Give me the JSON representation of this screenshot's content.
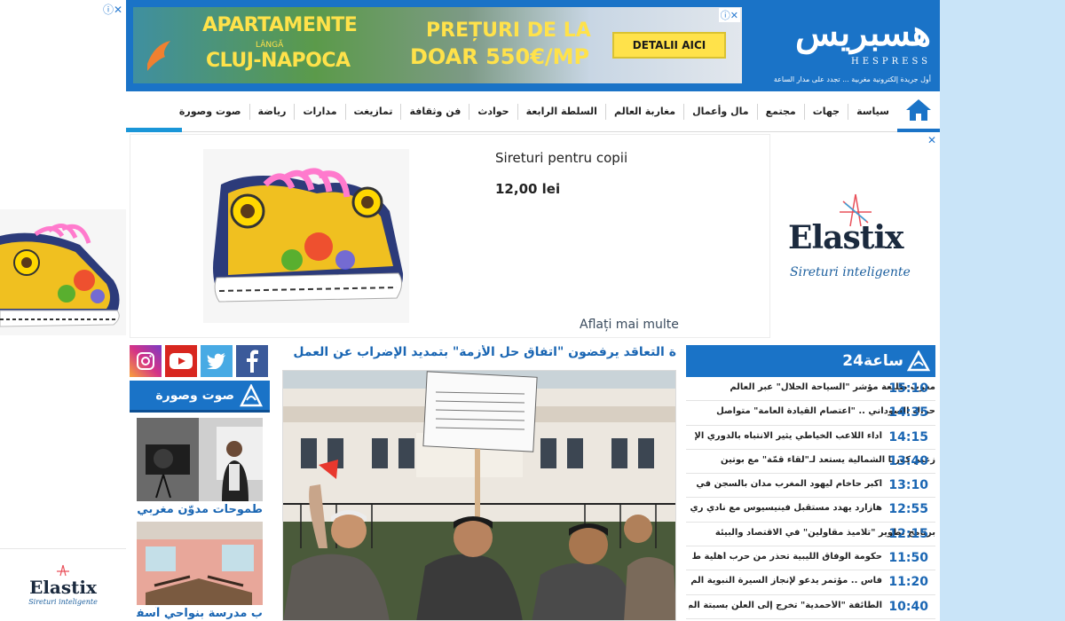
{
  "left_ad": {
    "adchoices": "ⓘ✕",
    "brand": "Elastix",
    "tagline": "Sireturi inteligente"
  },
  "header": {
    "logo_arabic": "هسبريس",
    "logo_latin": "HESPRESS",
    "tagline": "أول جريدة إلكترونية مغربية ... تجدد على مدار الساعة",
    "ad": {
      "line1": "APARTAMENTE",
      "line2": "LÂNGĂ",
      "line3": "CLUJ-NAPOCA",
      "line4": "PREȚURI DE LA",
      "line5": "DOAR 550€/MP",
      "button": "DETALII AICI",
      "close": "ⓘ✕"
    }
  },
  "nav": {
    "items": [
      "سياسة",
      "جهات",
      "مجتمع",
      "مال وأعمال",
      "مغاربة العالم",
      "السلطة الرابعة",
      "حوادث",
      "فن وثقافة",
      "تمازيغت",
      "مدارات",
      "رياضة",
      "صوت وصورة"
    ]
  },
  "mid_ad": {
    "product": "Sireturi pentru copii",
    "price": "12,00 lei",
    "learn_more": "Aflați mai multe",
    "brand": "Elastix",
    "brand_tagline": "Sireturi inteligente",
    "close": "✕"
  },
  "av": {
    "section_title": "صوت وصورة",
    "items": [
      {
        "title": "طموحات مدوّن مغربي"
      },
      {
        "title": "ب مدرسة بنواحي آسفي"
      }
    ]
  },
  "feature": {
    "headline": "ة التعاقد يرفضون \"اتفاق حل الأزمة\" بتمديد الإضراب عن العمل"
  },
  "latest": {
    "title": "24ساعة",
    "items": [
      {
        "time": "15:10",
        "headline": "مغرب طليعة مؤشر \"السياحة الحلال\" عبر العالم",
        "overlap": true
      },
      {
        "time": "14:35",
        "headline": "حراك السوداني .. \"اعتصام القيادة العامة\" متواصل",
        "overlap": true
      },
      {
        "time": "14:15",
        "headline": "أداء اللاعب الخياطي يثير الانتباه بالدوري الإ",
        "overlap": false
      },
      {
        "time": "13:40",
        "headline": "زعيم كوريا الشمالية يستعد لـ\"لقاء قمّة\" مع بوتين",
        "overlap": true
      },
      {
        "time": "13:10",
        "headline": "أكبر حاخام ليهود المغرب مدان بالسجن في",
        "overlap": false
      },
      {
        "time": "12:55",
        "headline": "هازارد يهدد مستقبل فينيسيوس مع نادي ري",
        "overlap": false
      },
      {
        "time": "12:15",
        "headline": "برنامج تطوير \"تلاميذ مقاولين\" في الاقتصاد والبيئة",
        "overlap": true
      },
      {
        "time": "11:50",
        "headline": "حكومة الوفاق الليبية تحذر من حرب أهلية ط",
        "overlap": false
      },
      {
        "time": "11:20",
        "headline": "فاس .. مؤتمر يدعو لإنجاز السيرة النبوية الم",
        "overlap": false
      },
      {
        "time": "10:40",
        "headline": "الطائفة \"الأحمدية\" تخرج إلى العلن بسبتة الم",
        "overlap": false
      }
    ]
  },
  "colors": {
    "brand_blue": "#1a73c7",
    "link_blue": "#1a66b3"
  }
}
